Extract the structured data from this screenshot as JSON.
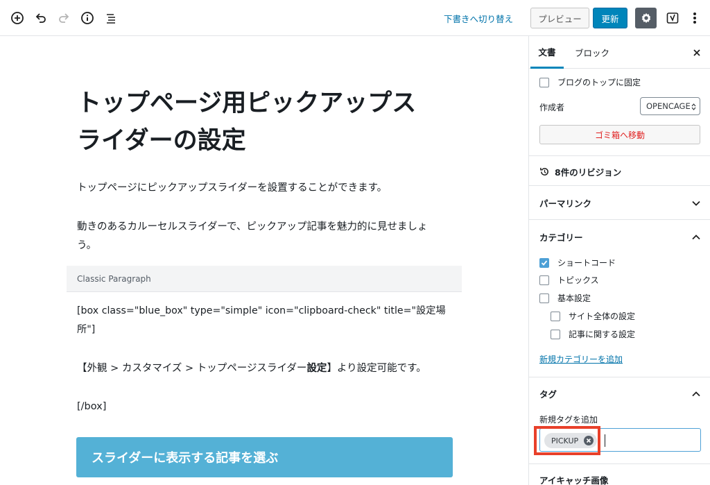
{
  "toolbar": {
    "add_block_icon": "plus-circle-icon",
    "undo_icon": "undo-icon",
    "redo_icon": "redo-icon",
    "info_icon": "info-icon",
    "outline_icon": "list-icon",
    "switch_draft": "下書きへ切り替え",
    "preview": "プレビュー",
    "update": "更新",
    "settings_icon": "gear-icon",
    "yoast_icon": "yoast-icon",
    "more_icon": "more-vertical-icon"
  },
  "editor": {
    "title_line1": "トップページ用ピックアップス",
    "title_line2": "ライダーの設定",
    "para1": "トップページにピックアップスライダーを設置することができます。",
    "para2_line1": "動きのあるカルーセルスライダーで、ピックアップ記事を魅力的に見せましょ",
    "para2_line2": "う。",
    "classic_label": "Classic Paragraph",
    "shortcode_line1": "[box class=\"blue_box\" type=\"simple\" icon=\"clipboard-check\" title=\"設定場",
    "shortcode_line2": "所\"]",
    "body_prefix": "【外観 > カスタマイズ > トップページスライダー",
    "body_bold": "設定",
    "body_suffix": "】より設定可能です。",
    "shortcode_close": "[/box]",
    "slider_button": "スライダーに表示する記事を選ぶ"
  },
  "sidebar": {
    "tab_document": "文書",
    "tab_block": "ブロック",
    "close_icon": "close-icon",
    "sticky_label": "ブログのトップに固定",
    "author_label": "作成者",
    "author_value": "OPENCAGE",
    "trash": "ゴミ箱へ移動",
    "revisions": "8件のリビジョン",
    "permalink": "パーマリンク",
    "categories": "カテゴリー",
    "category_items": [
      {
        "label": "ショートコード",
        "checked": true
      },
      {
        "label": "トピックス",
        "checked": false
      },
      {
        "label": "基本設定",
        "checked": false
      },
      {
        "label": "サイト全体の設定",
        "checked": false
      },
      {
        "label": "記事に関する設定",
        "checked": false
      }
    ],
    "add_category": "新規カテゴリーを追加",
    "tags": "タグ",
    "add_tag_label": "新規タグを追加",
    "tag_chip": "PICKUP",
    "featured_image": "アイキャッチ画像"
  },
  "colors": {
    "accent": "#0085ba",
    "link": "#0073aa",
    "highlight": "#e8402a",
    "slider_button": "#54b1d6",
    "trash": "#e02020"
  }
}
